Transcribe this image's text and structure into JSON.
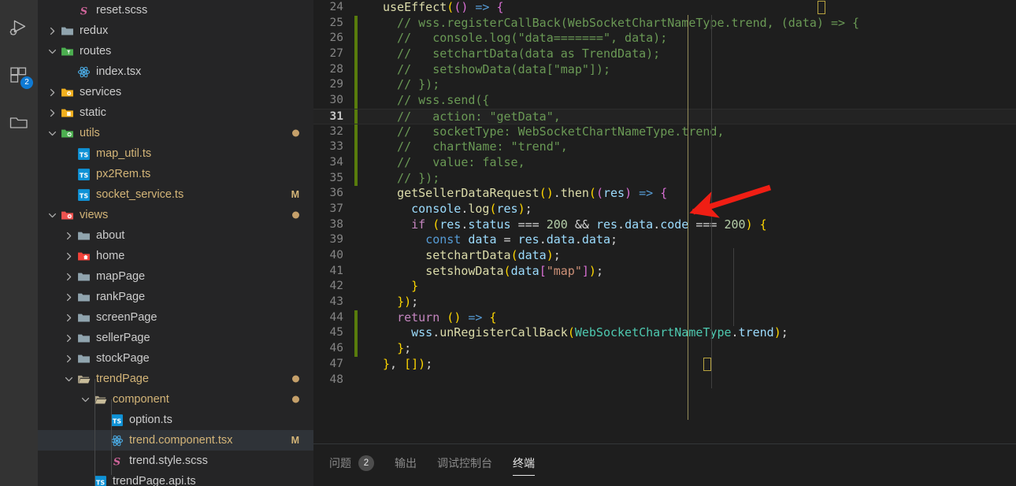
{
  "activity_bar": {
    "items": [
      {
        "name": "run-and-debug",
        "icon": "run-debug-icon",
        "badge": null
      },
      {
        "name": "extensions",
        "icon": "extensions-icon",
        "badge": "2"
      },
      {
        "name": "explorer-folder",
        "icon": "folder-icon",
        "badge": null
      }
    ]
  },
  "sidebar": {
    "tree": [
      {
        "label": "reset.scss",
        "indent": 3,
        "twisty": "none",
        "icon": "scss-icon",
        "color": "default",
        "badge": "",
        "dot": false,
        "selected": false
      },
      {
        "label": "redux",
        "indent": 2,
        "twisty": "right",
        "icon": "folder-grey",
        "color": "default",
        "badge": "",
        "dot": false,
        "selected": false
      },
      {
        "label": "routes",
        "indent": 2,
        "twisty": "down",
        "icon": "folder-routes",
        "color": "default",
        "badge": "",
        "dot": false,
        "selected": false
      },
      {
        "label": "index.tsx",
        "indent": 3,
        "twisty": "none",
        "icon": "react-icon",
        "color": "default",
        "badge": "",
        "dot": false,
        "selected": false
      },
      {
        "label": "services",
        "indent": 2,
        "twisty": "right",
        "icon": "folder-gear",
        "color": "default",
        "badge": "",
        "dot": false,
        "selected": false
      },
      {
        "label": "static",
        "indent": 2,
        "twisty": "right",
        "icon": "folder-static",
        "color": "default",
        "badge": "",
        "dot": false,
        "selected": false
      },
      {
        "label": "utils",
        "indent": 2,
        "twisty": "down",
        "icon": "folder-utils",
        "color": "mod",
        "badge": "",
        "dot": true,
        "selected": false
      },
      {
        "label": "map_util.ts",
        "indent": 3,
        "twisty": "none",
        "icon": "ts-icon",
        "color": "mod",
        "badge": "",
        "dot": false,
        "selected": false
      },
      {
        "label": "px2Rem.ts",
        "indent": 3,
        "twisty": "none",
        "icon": "ts-icon",
        "color": "mod",
        "badge": "",
        "dot": false,
        "selected": false
      },
      {
        "label": "socket_service.ts",
        "indent": 3,
        "twisty": "none",
        "icon": "ts-icon",
        "color": "mod",
        "badge": "M",
        "dot": false,
        "selected": false
      },
      {
        "label": "views",
        "indent": 2,
        "twisty": "down",
        "icon": "folder-views",
        "color": "mod",
        "badge": "",
        "dot": true,
        "selected": false
      },
      {
        "label": "about",
        "indent": 3,
        "twisty": "right",
        "icon": "folder-grey",
        "color": "default",
        "badge": "",
        "dot": false,
        "selected": false
      },
      {
        "label": "home",
        "indent": 3,
        "twisty": "right",
        "icon": "folder-home",
        "color": "default",
        "badge": "",
        "dot": false,
        "selected": false
      },
      {
        "label": "mapPage",
        "indent": 3,
        "twisty": "right",
        "icon": "folder-grey",
        "color": "default",
        "badge": "",
        "dot": false,
        "selected": false
      },
      {
        "label": "rankPage",
        "indent": 3,
        "twisty": "right",
        "icon": "folder-grey",
        "color": "default",
        "badge": "",
        "dot": false,
        "selected": false
      },
      {
        "label": "screenPage",
        "indent": 3,
        "twisty": "right",
        "icon": "folder-grey",
        "color": "default",
        "badge": "",
        "dot": false,
        "selected": false
      },
      {
        "label": "sellerPage",
        "indent": 3,
        "twisty": "right",
        "icon": "folder-grey",
        "color": "default",
        "badge": "",
        "dot": false,
        "selected": false
      },
      {
        "label": "stockPage",
        "indent": 3,
        "twisty": "right",
        "icon": "folder-grey",
        "color": "default",
        "badge": "",
        "dot": false,
        "selected": false
      },
      {
        "label": "trendPage",
        "indent": 3,
        "twisty": "down",
        "icon": "folder-open",
        "color": "mod",
        "badge": "",
        "dot": true,
        "selected": false
      },
      {
        "label": "component",
        "indent": 4,
        "twisty": "down",
        "icon": "folder-open",
        "color": "mod",
        "badge": "",
        "dot": true,
        "selected": false
      },
      {
        "label": "option.ts",
        "indent": 5,
        "twisty": "none",
        "icon": "ts-icon",
        "color": "default",
        "badge": "",
        "dot": false,
        "selected": false
      },
      {
        "label": "trend.component.tsx",
        "indent": 5,
        "twisty": "none",
        "icon": "react-icon",
        "color": "mod",
        "badge": "M",
        "dot": false,
        "selected": true
      },
      {
        "label": "trend.style.scss",
        "indent": 5,
        "twisty": "none",
        "icon": "scss-icon",
        "color": "default",
        "badge": "",
        "dot": false,
        "selected": false
      },
      {
        "label": "trendPage.api.ts",
        "indent": 4,
        "twisty": "none",
        "icon": "ts-icon",
        "color": "default",
        "badge": "",
        "dot": false,
        "selected": false
      }
    ]
  },
  "editor": {
    "active_line": 31,
    "first_line": 24,
    "lines": [
      {
        "n": 24,
        "change": false,
        "text": "useEffect(() => {"
      },
      {
        "n": 25,
        "change": true,
        "text": "  // wss.registerCallBack(WebSocketChartNameType.trend, (data) => {"
      },
      {
        "n": 26,
        "change": true,
        "text": "  //   console.log(\"data=======\", data);"
      },
      {
        "n": 27,
        "change": true,
        "text": "  //   setchartData(data as TrendData);"
      },
      {
        "n": 28,
        "change": true,
        "text": "  //   setshowData(data[\"map\"]);"
      },
      {
        "n": 29,
        "change": true,
        "text": "  // });"
      },
      {
        "n": 30,
        "change": true,
        "text": "  // wss.send({"
      },
      {
        "n": 31,
        "change": true,
        "text": "  //   action: \"getData\","
      },
      {
        "n": 32,
        "change": true,
        "text": "  //   socketType: WebSocketChartNameType.trend,"
      },
      {
        "n": 33,
        "change": true,
        "text": "  //   chartName: \"trend\","
      },
      {
        "n": 34,
        "change": true,
        "text": "  //   value: false,"
      },
      {
        "n": 35,
        "change": true,
        "text": "  // });"
      },
      {
        "n": 36,
        "change": false,
        "text": "  getSellerDataRequest().then((res) => {"
      },
      {
        "n": 37,
        "change": false,
        "text": "    console.log(res);"
      },
      {
        "n": 38,
        "change": false,
        "text": "    if (res.status === 200 && res.data.code === 200) {"
      },
      {
        "n": 39,
        "change": false,
        "text": "      const data = res.data.data;"
      },
      {
        "n": 40,
        "change": false,
        "text": "      setchartData(data);"
      },
      {
        "n": 41,
        "change": false,
        "text": "      setshowData(data[\"map\"]);"
      },
      {
        "n": 42,
        "change": false,
        "text": "    }"
      },
      {
        "n": 43,
        "change": false,
        "text": "  });"
      },
      {
        "n": 44,
        "change": true,
        "text": "  return () => {"
      },
      {
        "n": 45,
        "change": true,
        "text": "    wss.unRegisterCallBack(WebSocketChartNameType.trend);"
      },
      {
        "n": 46,
        "change": true,
        "text": "  };"
      },
      {
        "n": 47,
        "change": false,
        "text": "}, []);"
      },
      {
        "n": 48,
        "change": false,
        "text": ""
      }
    ]
  },
  "panel": {
    "tabs": [
      {
        "label": "问题",
        "badge": "2",
        "active": false
      },
      {
        "label": "输出",
        "badge": "",
        "active": false
      },
      {
        "label": "调试控制台",
        "badge": "",
        "active": false
      },
      {
        "label": "终端",
        "badge": "",
        "active": true
      }
    ]
  },
  "annotation": {
    "arrow_color": "#f01e14",
    "description": "red-arrow-pointing-to-line-36"
  },
  "colors": {
    "activity_bar_bg": "#333333",
    "sidebar_bg": "#252526",
    "editor_bg": "#1e1e1e",
    "selection_bg": "#2f3338",
    "badge_blue": "#0e7ad4",
    "change_green": "#587c0c",
    "modified_text": "#d4b578"
  }
}
